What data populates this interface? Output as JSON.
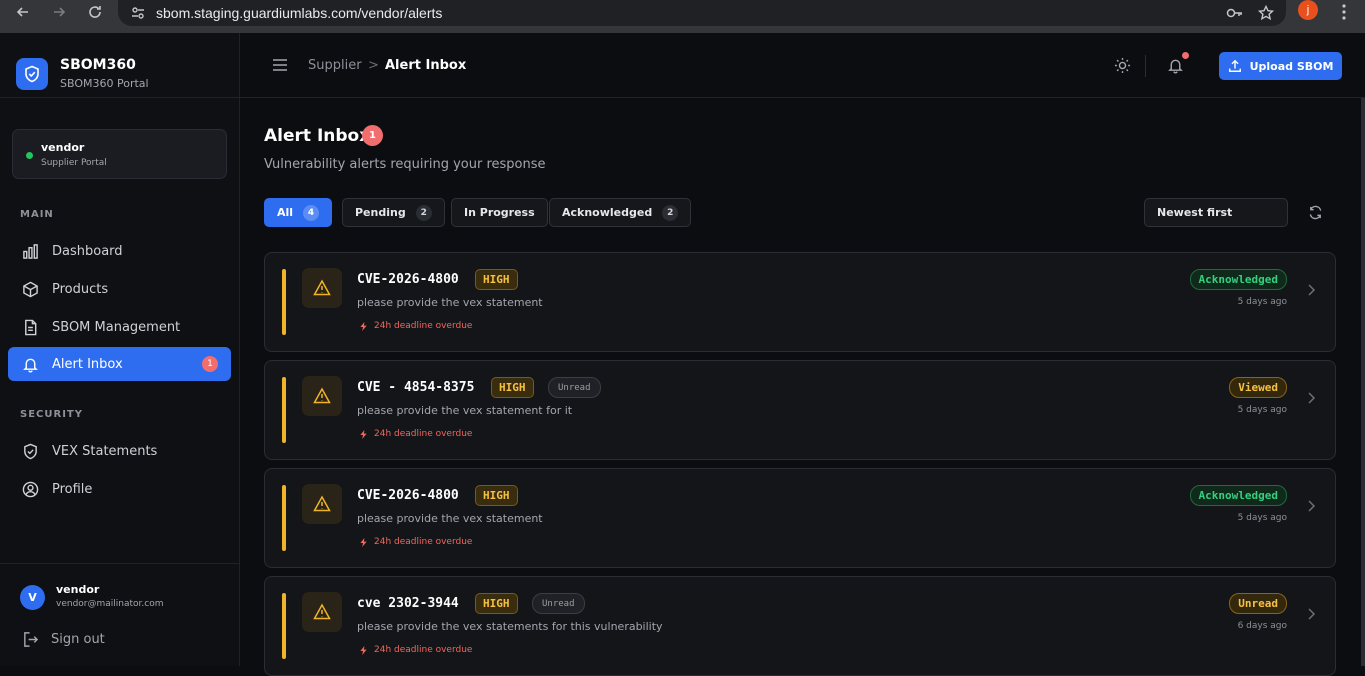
{
  "browser": {
    "url": "sbom.staging.guardiumlabs.com/vendor/alerts",
    "profile_initial": "j"
  },
  "brand": {
    "title": "SBOM360",
    "subtitle": "SBOM360 Portal"
  },
  "vendor_card": {
    "name": "vendor",
    "portal": "Supplier Portal"
  },
  "sidebar": {
    "main_label": "MAIN",
    "security_label": "SECURITY",
    "items": [
      {
        "label": "Dashboard",
        "icon": "bar-chart-icon"
      },
      {
        "label": "Products",
        "icon": "box-icon"
      },
      {
        "label": "SBOM Management",
        "icon": "document-icon"
      },
      {
        "label": "Alert Inbox",
        "icon": "bell-icon",
        "badge": "1",
        "active": true
      },
      {
        "label": "VEX Statements",
        "icon": "shield-check-icon"
      },
      {
        "label": "Profile",
        "icon": "user-circle-icon"
      }
    ]
  },
  "user": {
    "initial": "V",
    "name": "vendor",
    "email": "vendor@mailinator.com",
    "signout": "Sign out"
  },
  "header": {
    "breadcrumb_parent": "Supplier",
    "breadcrumb_sep": ">",
    "breadcrumb_current": "Alert Inbox",
    "upload_label": "Upload SBOM"
  },
  "main": {
    "title": "Alert Inbox",
    "title_badge": "1",
    "subtitle": "Vulnerability alerts requiring your response",
    "filters": [
      {
        "label": "All",
        "count": "4",
        "active": true
      },
      {
        "label": "Pending",
        "count": "2"
      },
      {
        "label": "In Progress",
        "count": ""
      },
      {
        "label": "Acknowledged",
        "count": "2"
      }
    ],
    "sort_value": "Newest first"
  },
  "alerts": [
    {
      "cve": "CVE-2026-4800",
      "severity": "HIGH",
      "unread_tag": "",
      "desc": "please provide the vex statement",
      "deadline": "24h deadline overdue",
      "status": "Acknowledged",
      "ago": "5 days ago"
    },
    {
      "cve": "CVE - 4854-8375",
      "severity": "HIGH",
      "unread_tag": "Unread",
      "desc": "please provide the vex statement for it",
      "deadline": "24h deadline overdue",
      "status": "Viewed",
      "ago": "5 days ago"
    },
    {
      "cve": "CVE-2026-4800",
      "severity": "HIGH",
      "unread_tag": "",
      "desc": "please provide the vex statement",
      "deadline": "24h deadline overdue",
      "status": "Acknowledged",
      "ago": "5 days ago"
    },
    {
      "cve": "cve 2302-3944",
      "severity": "HIGH",
      "unread_tag": "Unread",
      "desc": "please provide the vex statements for this vulnerability",
      "deadline": "24h deadline overdue",
      "status": "Unread",
      "ago": "6 days ago"
    }
  ]
}
